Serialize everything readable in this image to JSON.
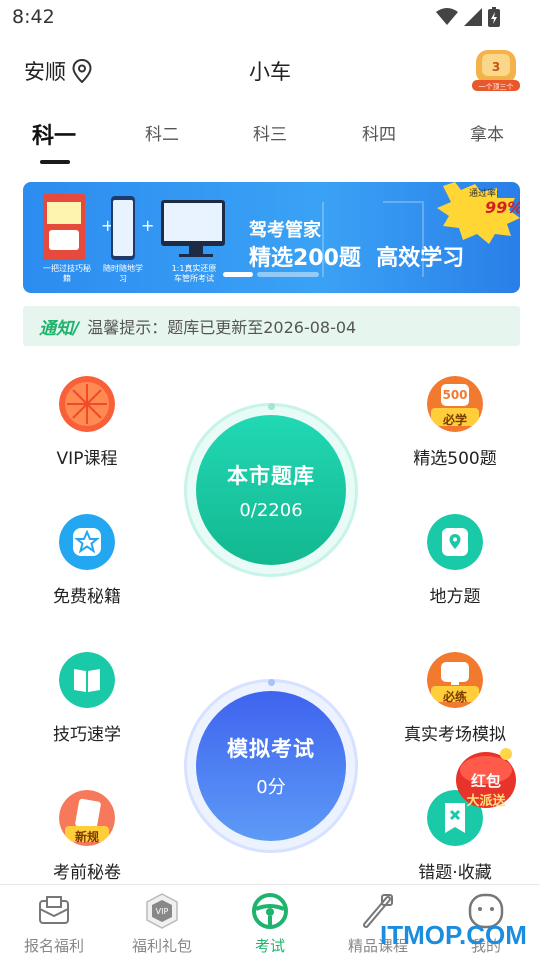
{
  "status_bar": {
    "time": "8:42"
  },
  "header": {
    "city": "安顺",
    "car_type": "小车",
    "badge_text": "一个顶三个"
  },
  "tabs": [
    {
      "label": "科一",
      "active": true
    },
    {
      "label": "科二",
      "active": false
    },
    {
      "label": "科三",
      "active": false
    },
    {
      "label": "科四",
      "active": false
    },
    {
      "label": "拿本",
      "active": false
    }
  ],
  "banner": {
    "brand": "驾考管家",
    "headline": "精选200题  高效学习",
    "pass_rate_label": "通过率:",
    "pass_rate": "99%",
    "captions": [
      "一把过技巧秘籍",
      "随时随地学习",
      "1:1真实还原车管所考试"
    ]
  },
  "notice": {
    "tag": "通知/",
    "text": "温馨提示：题库已更新至2026-08-04"
  },
  "grid": {
    "vip": "VIP课程",
    "selected500": "精选500题",
    "free_secrets": "免费秘籍",
    "local": "地方题",
    "tips": "技巧速学",
    "real_exam": "真实考场模拟",
    "pre_exam": "考前秘卷",
    "errors": "错题·收藏",
    "badge_500": "500",
    "badge_must_learn": "必学",
    "badge_must_practice": "必练",
    "badge_new": "新规"
  },
  "city_bank": {
    "title": "本市题库",
    "progress": "0/2206"
  },
  "mock_exam": {
    "title": "模拟考试",
    "score": "0分"
  },
  "hongbao": {
    "line1": "红包",
    "line2": "大派送"
  },
  "bottom_nav": [
    {
      "label": "报名福利",
      "active": false
    },
    {
      "label": "福利礼包",
      "active": false
    },
    {
      "label": "考试",
      "active": true
    },
    {
      "label": "精品课程",
      "active": false
    },
    {
      "label": "我的",
      "active": false
    }
  ],
  "watermark": "ITMOP.COM",
  "colors": {
    "accent": "#1fb36e",
    "teal": "#19c9a7",
    "blue": "#3d6cf0",
    "banner": "#2d8cf0"
  }
}
